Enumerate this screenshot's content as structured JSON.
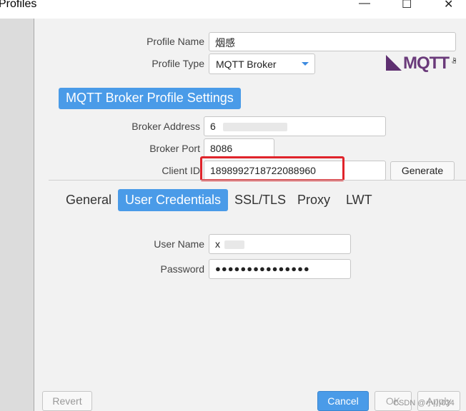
{
  "window": {
    "title": "Profiles",
    "minimize_glyph": "—",
    "maximize_glyph": "☐",
    "close_glyph": "✕"
  },
  "profile": {
    "name_label": "Profile Name",
    "name_value": "烟感",
    "type_label": "Profile Type",
    "type_value": "MQTT Broker"
  },
  "logo": {
    "text": "MQTT",
    "org": ".org"
  },
  "section_title": "MQTT Broker Profile Settings",
  "broker": {
    "address_label": "Broker Address",
    "address_value": "6",
    "port_label": "Broker Port",
    "port_value": "8086",
    "client_id_label": "Client ID",
    "client_id_value": "1898992718722088960",
    "generate_label": "Generate"
  },
  "tabs": [
    {
      "label": "General",
      "active": false
    },
    {
      "label": "User Credentials",
      "active": true
    },
    {
      "label": "SSL/TLS",
      "active": false
    },
    {
      "label": "Proxy",
      "active": false
    },
    {
      "label": "LWT",
      "active": false
    }
  ],
  "credentials": {
    "user_label": "User Name",
    "user_value": "x",
    "password_label": "Password",
    "password_value": "●●●●●●●●●●●●●●●"
  },
  "footer": {
    "revert_label": "Revert",
    "cancel_label": "Cancel",
    "ok_label": "OK",
    "apply_label": "Apply"
  },
  "watermark": "CSDN @小小024"
}
